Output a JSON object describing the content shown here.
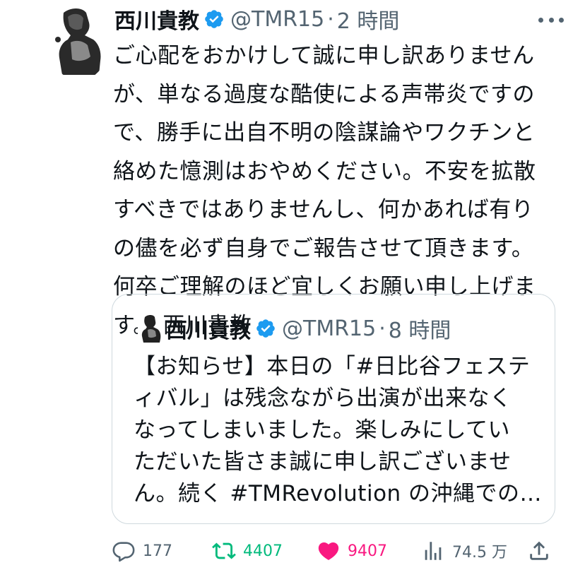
{
  "tweet": {
    "author_name": "西川貴教",
    "handle": "@TMR15",
    "separator": "·",
    "time": "2 時間",
    "body_lines": [
      "ご心配をおかけして誠に申し訳ありません",
      "が、単なる過度な酷使による声帯炎ですの",
      "で、勝手に出自不明の陰謀論やワクチンと",
      "絡めた憶測はおやめください。不安を拡散",
      "すべきではありませんし、何かあれば有り",
      "の儘を必ず自身でご報告させて頂きます。",
      "何卒ご理解のほど宜しくお願い申し上げま",
      "す。 西川貴教"
    ]
  },
  "quote": {
    "author_name": "西川貴教",
    "handle": "@TMR15",
    "separator": "·",
    "time": "8 時間",
    "body_lines": [
      "【お知らせ】本日の「#日比谷フェステ",
      "ィバル」は残念ながら出演が出来なく",
      "なってしまいました。楽しみにしてい",
      "ただいた皆さま誠に申し訳ございませ",
      "ん。続く #TMRevolution の沖縄での…"
    ]
  },
  "actions": {
    "reply_count": "177",
    "retweet_count": "4407",
    "like_count": "9407",
    "views_count": "74.5 万"
  },
  "colors": {
    "text_primary": "#0f1419",
    "text_secondary": "#536471",
    "verified_blue": "#1d9bf0",
    "retweet_green": "#00ba7c",
    "like_pink": "#f91880",
    "border": "#cfd9de"
  },
  "icons": {
    "verified": "verified-badge-icon",
    "more": "more-options-icon",
    "reply": "reply-icon",
    "retweet": "retweet-icon",
    "like": "heart-icon",
    "views": "views-icon",
    "share": "share-icon"
  }
}
